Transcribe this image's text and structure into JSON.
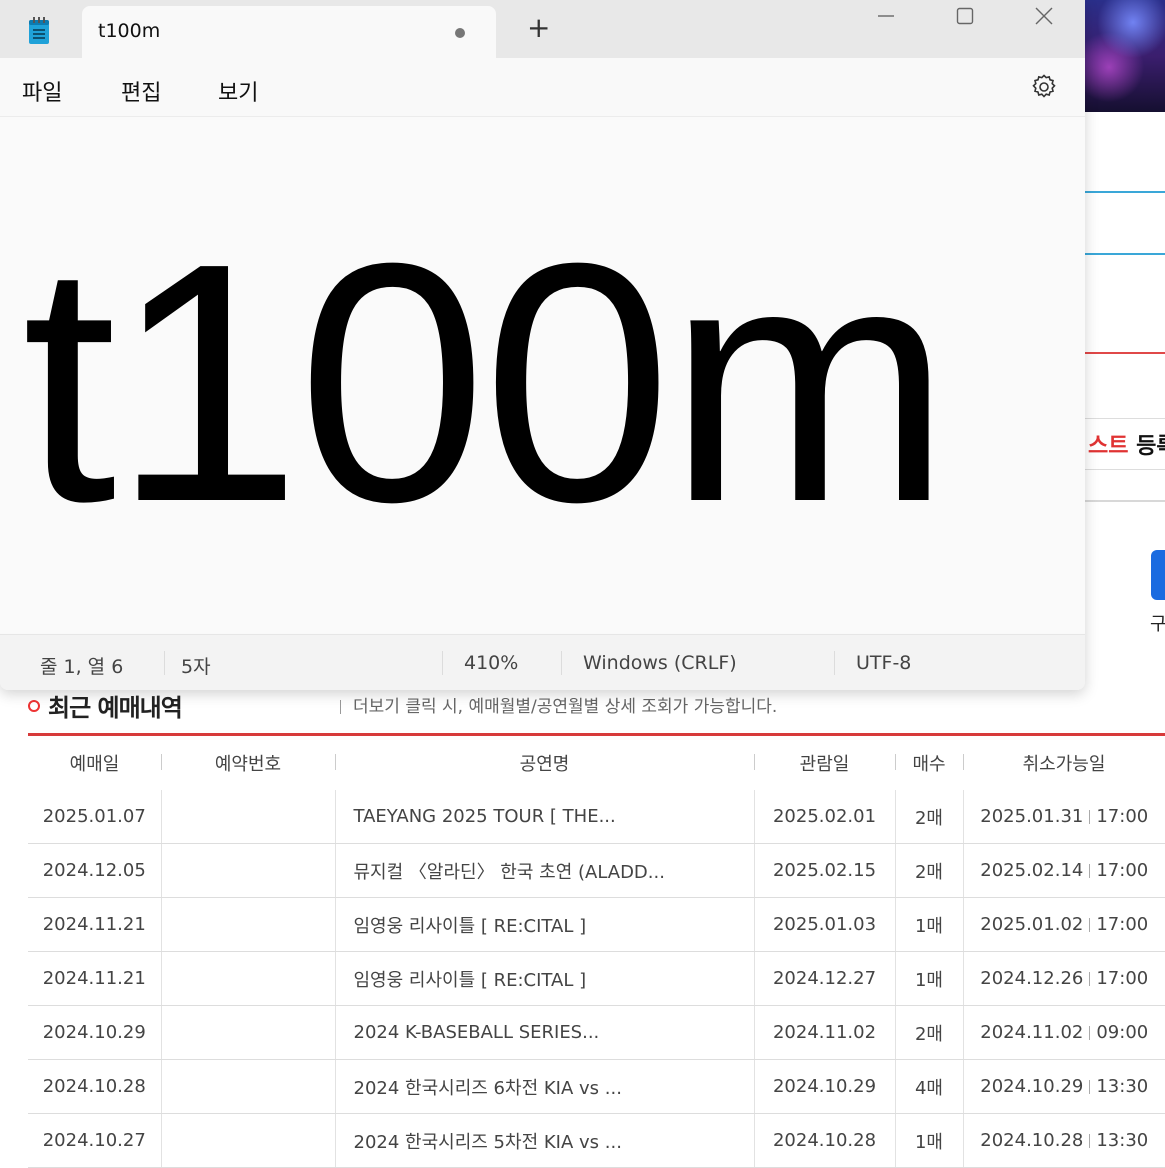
{
  "notepad": {
    "tab_title": "t100m",
    "new_tab": "+",
    "menu": {
      "file": "파일",
      "edit": "편집",
      "view": "보기"
    },
    "content": "t100m",
    "status": {
      "position": "줄 1, 열 6",
      "chars": "5자",
      "zoom": "410%",
      "line_ending": "Windows (CRLF)",
      "encoding": "UTF-8"
    }
  },
  "background_page": {
    "register_text_red": "스트",
    "register_text_rest": " 등록",
    "button_caption": "구",
    "section_title": "최근 예매내역",
    "section_note": "더보기 클릭 시, 예매월별/공연월별 상세 조회가 가능합니다.",
    "table": {
      "headers": {
        "booked_date": "예매일",
        "reservation_no": "예약번호",
        "show_name": "공연명",
        "view_date": "관람일",
        "count": "매수",
        "cancel_deadline": "취소가능일"
      },
      "rows": [
        {
          "booked_date": "2025.01.07",
          "reservation_no": "",
          "show_name": "TAEYANG 2025 TOUR  [ THE...",
          "view_date": "2025.02.01",
          "count": "2매",
          "cancel_date": "2025.01.31",
          "cancel_time": "17:00"
        },
        {
          "booked_date": "2024.12.05",
          "reservation_no": "",
          "show_name": "뮤지컬 〈알라딘〉 한국 초연 (ALADD...",
          "view_date": "2025.02.15",
          "count": "2매",
          "cancel_date": "2025.02.14",
          "cancel_time": "17:00"
        },
        {
          "booked_date": "2024.11.21",
          "reservation_no": "",
          "show_name": "임영웅 리사이틀  [ RE:CITAL ]",
          "view_date": "2025.01.03",
          "count": "1매",
          "cancel_date": "2025.01.02",
          "cancel_time": "17:00"
        },
        {
          "booked_date": "2024.11.21",
          "reservation_no": "",
          "show_name": "임영웅 리사이틀  [ RE:CITAL ]",
          "view_date": "2024.12.27",
          "count": "1매",
          "cancel_date": "2024.12.26",
          "cancel_time": "17:00"
        },
        {
          "booked_date": "2024.10.29",
          "reservation_no": "",
          "show_name": "2024 K-BASEBALL SERIES...",
          "view_date": "2024.11.02",
          "count": "2매",
          "cancel_date": "2024.11.02",
          "cancel_time": "09:00"
        },
        {
          "booked_date": "2024.10.28",
          "reservation_no": "",
          "show_name": "2024 한국시리즈 6차전 KIA vs ...",
          "view_date": "2024.10.29",
          "count": "4매",
          "cancel_date": "2024.10.29",
          "cancel_time": "13:30"
        },
        {
          "booked_date": "2024.10.27",
          "reservation_no": "",
          "show_name": "2024 한국시리즈 5차전 KIA vs ...",
          "view_date": "2024.10.28",
          "count": "1매",
          "cancel_date": "2024.10.28",
          "cancel_time": "13:30"
        }
      ]
    }
  },
  "colors": {
    "accent_red": "#d83838",
    "notepad_icon": "#1fa1d8"
  },
  "icons": [
    "notepad-app-icon",
    "minimize-icon",
    "maximize-icon",
    "close-icon",
    "settings-gear-icon"
  ]
}
